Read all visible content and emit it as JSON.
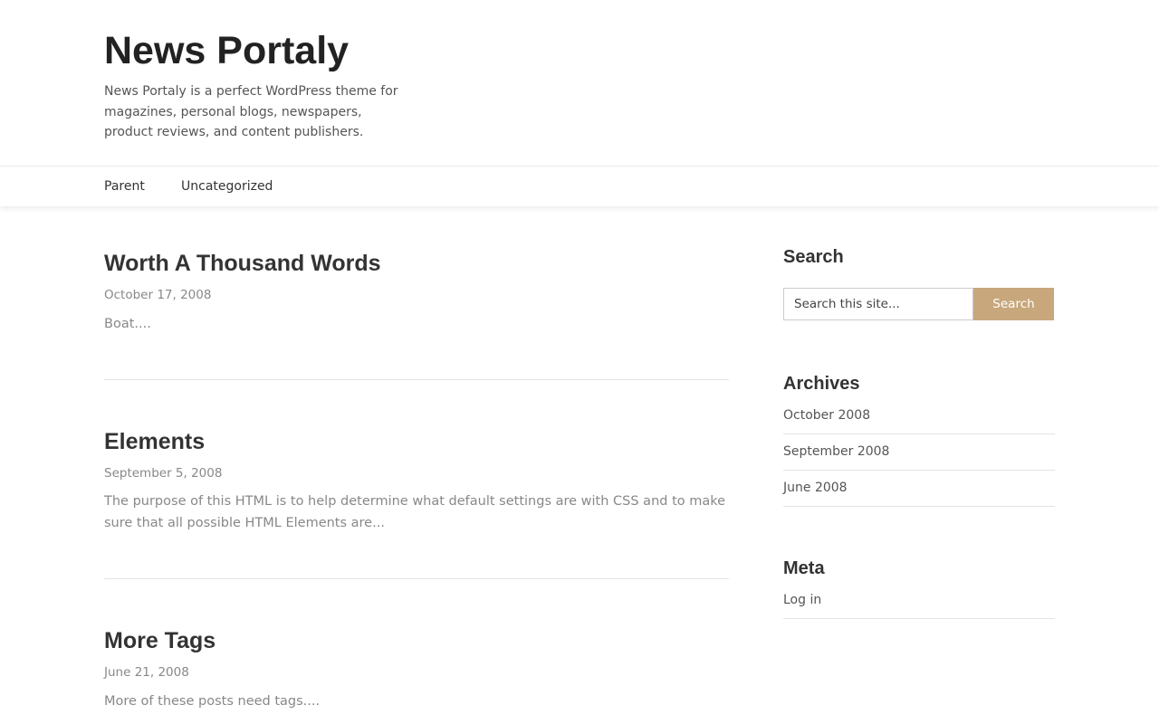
{
  "site": {
    "title": "News Portaly",
    "tagline": "News Portaly is a perfect WordPress theme for magazines, personal blogs, newspapers, product reviews, and content publishers."
  },
  "nav": {
    "items": [
      {
        "label": "Parent"
      },
      {
        "label": "Uncategorized"
      }
    ]
  },
  "posts": [
    {
      "title": "Worth A Thousand Words",
      "date": "October 17, 2008",
      "excerpt": "Boat...."
    },
    {
      "title": "Elements",
      "date": "September 5, 2008",
      "excerpt": "The purpose of this HTML is to help determine what default settings are with CSS and to make sure that all possible HTML Elements are..."
    },
    {
      "title": "More Tags",
      "date": "June 21, 2008",
      "excerpt": "More of these posts need tags...."
    }
  ],
  "sidebar": {
    "search": {
      "title": "Search",
      "placeholder": "Search this site...",
      "button_label": "Search"
    },
    "archives": {
      "title": "Archives",
      "items": [
        {
          "label": "October 2008"
        },
        {
          "label": "September 2008"
        },
        {
          "label": "June 2008"
        }
      ]
    },
    "meta": {
      "title": "Meta",
      "items": [
        {
          "label": "Log in"
        }
      ]
    }
  },
  "colors": {
    "accent": "#c8a77c",
    "text": "#333333",
    "muted": "#888888"
  }
}
